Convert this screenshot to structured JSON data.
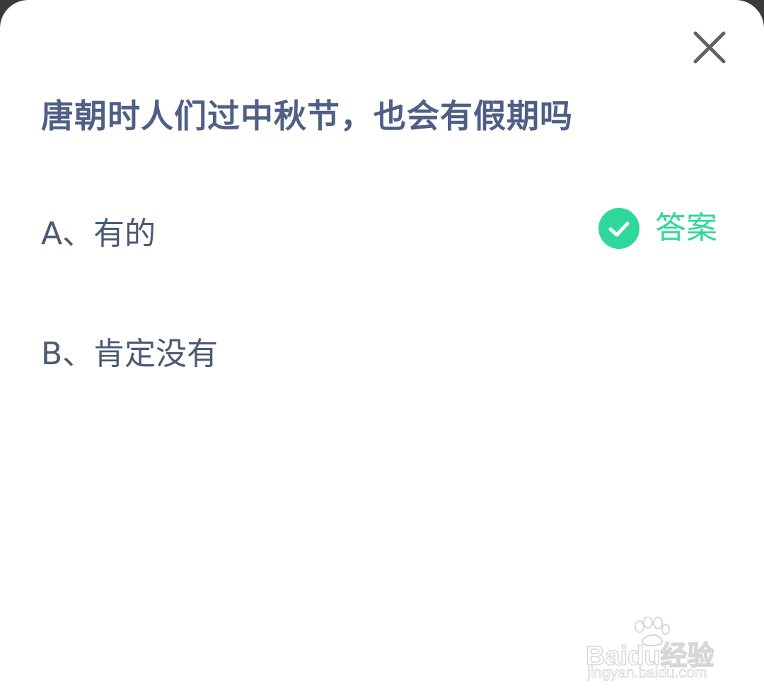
{
  "quiz": {
    "question": "唐朝时人们过中秋节，也会有假期吗",
    "options": [
      {
        "label": "A、有的",
        "is_answer": true
      },
      {
        "label": "B、肯定没有",
        "is_answer": false
      }
    ],
    "answer_label": "答案"
  },
  "icons": {
    "close": "close-icon",
    "check": "check-circle-icon"
  },
  "colors": {
    "question": "#4f5f86",
    "option_text": "#4a5a72",
    "answer_accent": "#2fd89a",
    "background": "#ffffff"
  },
  "watermark": {
    "brand": "Baidu经验",
    "url": "jingyan.baidu.com"
  }
}
